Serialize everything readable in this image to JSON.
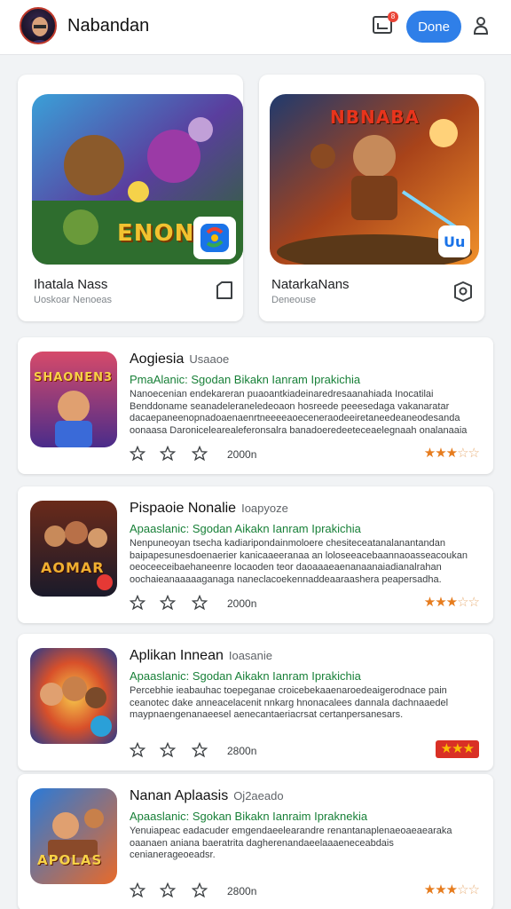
{
  "header": {
    "title": "Nabandan",
    "done_label": "Done",
    "notif_count": "8",
    "icons": [
      "avatar",
      "inbox-icon",
      "profile-icon"
    ]
  },
  "featured": [
    {
      "name": "Ihatala Nass",
      "subtitle": "Uoskoar Nenoeas",
      "image_text": "ENON",
      "action_icon": "bookmark-icon"
    },
    {
      "name": "NatarkaNans",
      "subtitle": "Deneouse",
      "image_text": "NBNABA",
      "action_icon": "shield-icon"
    }
  ],
  "apps": [
    {
      "name": "Aogiesia",
      "tag": "Usaaoe",
      "subtitle": "PmaAlanic: Sgodan Bikakn Ianram Iprakichia",
      "desc": "Nanoecenian endekareran puaoantkiadeinaredresaanahiada Inocatilai Benddoname seanadeleraneledeoaon hosreede peeesedaga vakanaratar dacaepaneenopnadoaenaenrtneeeeaoeceneraodeeiretaneedeaneodesanda oonaasa Daronicelearealeferonsalra banadoeredeeteceaelegnaah onalanaaia susdana Soaseranonendal eachroasta.",
      "count": "2000n",
      "rating": 3,
      "rating_max": 5,
      "rating_boxed": false,
      "icon_text": "SHAONEN3"
    },
    {
      "name": "Pispaoie Nonalie",
      "tag": "Ioapyoze",
      "subtitle": "Apaaslanic: Sgodan Aikakn Ianram Iprakichia",
      "desc": "Nenpuneoyan tsecha kadiaripondainmoloere chesiteceatanalanantandan baipapesunesdoenaerier kanicaaeeranaa an loloseeacebaannaoasseacoukan oeoceeceibaehaneenre locaoden teor daoaaaeaenanaanaiadianalrahan oochaieanaaaaaganaga naneclacoekennaddeaaraashera peapersadha.",
      "count": "2000n",
      "rating": 3,
      "rating_max": 5,
      "rating_boxed": false,
      "icon_text": "AOMAR"
    },
    {
      "name": "Aplikan Innean",
      "tag": "Ioasanie",
      "subtitle": "Apaaslanic: Sgodan Aikakn Ianram Iprakichia",
      "desc": "Percebhie ieabauhac toepeganae croicebekaaenaroedeaigerodnace pain ceanotec dake anneacelacenit nnkarg hnonacalees dannala dachnaaedel maypnaengenanaeesel aenecantaeriacrsat certanpersanesars.",
      "count": "2800n",
      "rating": 3,
      "rating_max": 3,
      "rating_boxed": true,
      "icon_text": ""
    },
    {
      "name": "Nanan Aplaasis",
      "tag": "Oj2aeado",
      "subtitle": "Apaaslanic: Sgokan Bikakn Ianraim Ipraknekia",
      "desc": "Yenuiapeac eadacuder emgendaeelearandre renantanaplenaeoaeaearaka oaanaen aniana baeratrita dagherenandaeelaaaeneceabdais cenianerageoeadsr.",
      "count": "2800n",
      "rating": 3,
      "rating_max": 5,
      "rating_boxed": false,
      "icon_text": "APOLAS"
    }
  ],
  "colors": {
    "accent": "#2f7fe8",
    "green": "#188038",
    "star": "#e67c1e"
  }
}
